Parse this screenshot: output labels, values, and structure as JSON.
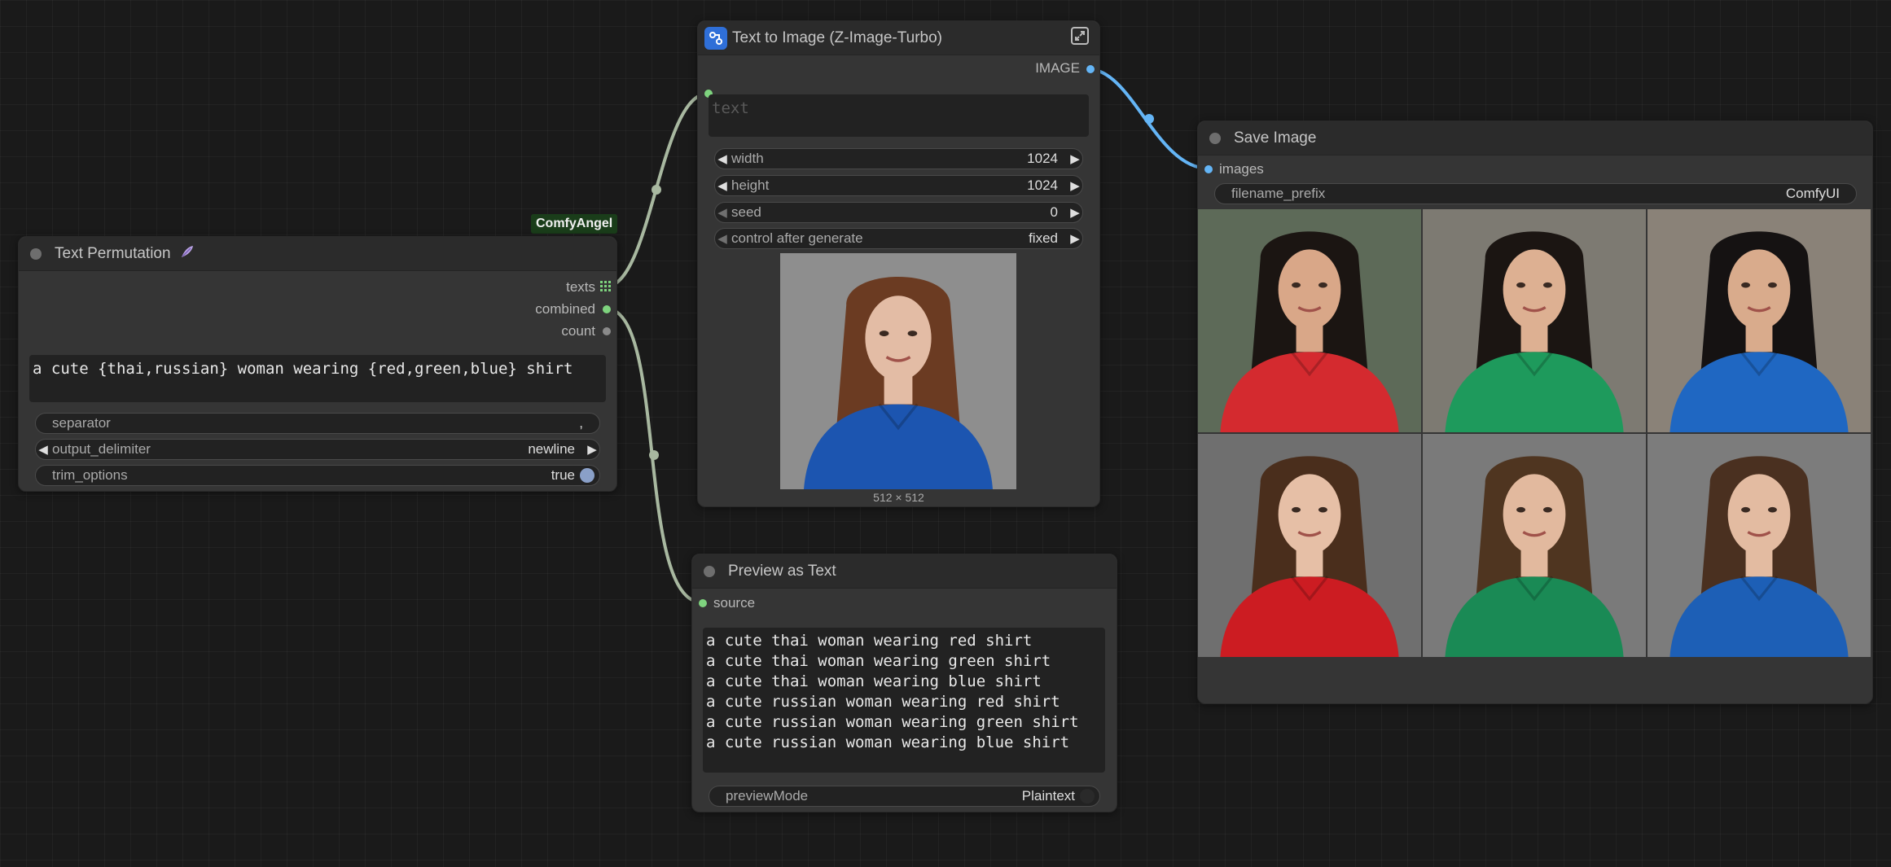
{
  "badge": "ComfyAngel",
  "text_permutation": {
    "title": "Text Permutation",
    "outputs": {
      "texts": "texts",
      "combined": "combined",
      "count": "count"
    },
    "template_text": "a cute {thai,russian} woman wearing {red,green,blue} shirt",
    "separator": {
      "label": "separator",
      "value": ","
    },
    "output_delimiter": {
      "label": "output_delimiter",
      "value": "newline"
    },
    "trim_options": {
      "label": "trim_options",
      "value": "true"
    }
  },
  "text_to_image": {
    "title": "Text to Image (Z-Image-Turbo)",
    "output": "IMAGE",
    "text_placeholder": "text",
    "width": {
      "label": "width",
      "value": "1024"
    },
    "height": {
      "label": "height",
      "value": "1024"
    },
    "seed": {
      "label": "seed",
      "value": "0"
    },
    "control_after_generate": {
      "label": "control after generate",
      "value": "fixed"
    },
    "preview_size": "512 × 512"
  },
  "preview_text": {
    "title": "Preview as Text",
    "input": "source",
    "lines": [
      "a cute thai woman wearing red shirt",
      "a cute thai woman wearing green shirt",
      "a cute thai woman wearing blue shirt",
      "a cute russian woman wearing red shirt",
      "a cute russian woman wearing green shirt",
      "a cute russian woman wearing blue shirt"
    ],
    "preview_mode": {
      "label": "previewMode",
      "value": "Plaintext"
    }
  },
  "save_image": {
    "title": "Save Image",
    "input": "images",
    "filename_prefix": {
      "label": "filename_prefix",
      "value": "ComfyUI"
    },
    "images": [
      {
        "shirt": "#d42a2f",
        "bg": "#5d6a58",
        "hair": "#1b1512",
        "skin": "#d9a788"
      },
      {
        "shirt": "#1e9a5c",
        "bg": "#7d7a72",
        "hair": "#1b1512",
        "skin": "#ddb092"
      },
      {
        "shirt": "#1f67c2",
        "bg": "#8a8278",
        "hair": "#151212",
        "skin": "#d9ab8c"
      },
      {
        "shirt": "#cc1c22",
        "bg": "#6f6f6f",
        "hair": "#4a2e1c",
        "skin": "#e6bfa6"
      },
      {
        "shirt": "#1a8a55",
        "bg": "#7a7a7a",
        "hair": "#4f3520",
        "skin": "#e2b99e"
      },
      {
        "shirt": "#1d5fb6",
        "bg": "#7c7c7c",
        "hair": "#4a3020",
        "skin": "#e3bba1"
      }
    ]
  },
  "preview_image": {
    "shirt": "#1c55b0",
    "bg": "#8e8e8e",
    "hair": "#6b3b22",
    "skin": "#e3bca5"
  },
  "colors": {
    "wire_string": "#a8b8a0",
    "wire_image": "#64b5f6",
    "slot_string": "#7ed37e",
    "slot_image": "#64b5f6"
  }
}
